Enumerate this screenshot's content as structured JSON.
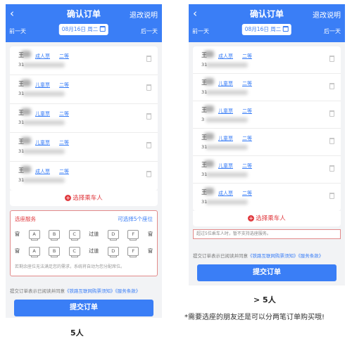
{
  "header": {
    "back_icon": "chevron-left-icon",
    "title": "确认订单",
    "refund_label": "退改说明",
    "prev_day": "前一天",
    "next_day": "后一天",
    "date_value": "08月16日 周二",
    "calendar_icon": "calendar-icon"
  },
  "left": {
    "passengers": [
      {
        "name": "王",
        "id_prefix": "31",
        "ticket_type": "成人票",
        "seat_class": "二等"
      },
      {
        "name": "王",
        "id_prefix": "31",
        "ticket_type": "儿童票",
        "seat_class": "二等"
      },
      {
        "name": "王",
        "id_prefix": "31",
        "ticket_type": "儿童票",
        "seat_class": "二等"
      },
      {
        "name": "王",
        "id_prefix": "31",
        "ticket_type": "儿童票",
        "seat_class": "二等"
      },
      {
        "name": "王",
        "id_prefix": "31",
        "ticket_type": "成人票",
        "seat_class": "二等"
      }
    ],
    "add_passenger": "选择乘车人",
    "seat_service": {
      "title": "选座服务",
      "remaining": "可选择5个座位",
      "window": "窗",
      "aisle": "过道",
      "seats_row1": [
        "A",
        "B",
        "C",
        "D",
        "F"
      ],
      "seats_row2": [
        "A",
        "B",
        "C",
        "D",
        "F"
      ],
      "note": "若剩余座位无法满足您的需求，系统将自动为您分配席位。"
    },
    "agree_prefix": "提交订单表示已阅读并同意",
    "agree_link1": "《铁路互联网购票须知》",
    "agree_link2": "《服务条款》",
    "submit": "提交订单",
    "caption": "5人"
  },
  "right": {
    "passengers": [
      {
        "name": "王",
        "id_prefix": "31",
        "ticket_type": "成人票",
        "seat_class": "二等"
      },
      {
        "name": "王",
        "id_prefix": "31",
        "ticket_type": "儿童票",
        "seat_class": "二等"
      },
      {
        "name": "王",
        "id_prefix": "3",
        "ticket_type": "儿童票",
        "seat_class": "二等"
      },
      {
        "name": "王",
        "id_prefix": "31",
        "ticket_type": "儿童票",
        "seat_class": "二等"
      },
      {
        "name": "王",
        "id_prefix": "31",
        "ticket_type": "儿童票",
        "seat_class": "二等"
      },
      {
        "name": "王",
        "id_prefix": "31",
        "ticket_type": "成人票",
        "seat_class": "二等"
      }
    ],
    "add_passenger": "选择乘车人",
    "warning": "超过5位乘车人时，暂不支持选座服务。",
    "agree_prefix": "提交订单表示已阅读并同意",
    "agree_link1": "《铁路互联网购票须知》",
    "agree_link2": "《服务条款》",
    "submit": "提交订单",
    "caption": "> 5人",
    "note": "*需要选座的朋友还是可以分两笔订单购买哦!"
  },
  "colors": {
    "primary": "#3a7ef6",
    "danger": "#e0393e",
    "highlight_border": "#e28a8a"
  }
}
